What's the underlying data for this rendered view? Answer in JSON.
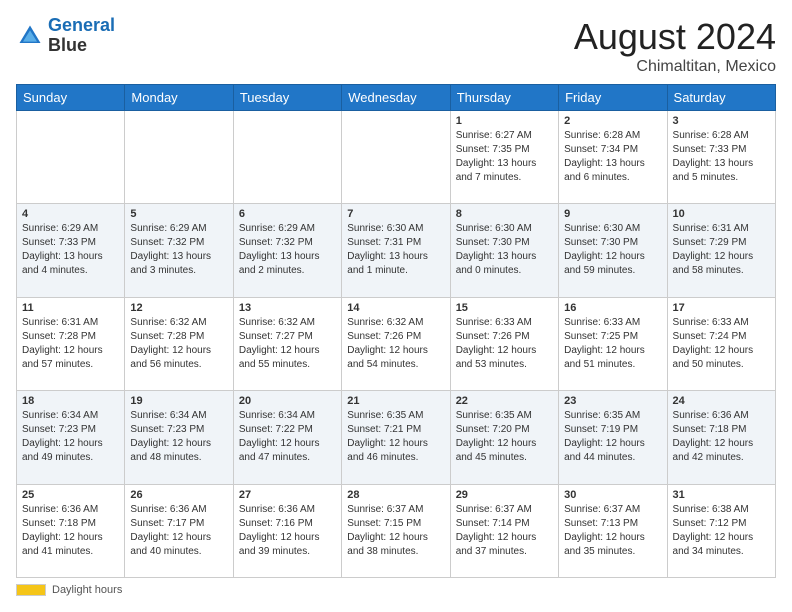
{
  "header": {
    "logo_line1": "General",
    "logo_line2": "Blue",
    "month": "August 2024",
    "location": "Chimaltitan, Mexico"
  },
  "days_of_week": [
    "Sunday",
    "Monday",
    "Tuesday",
    "Wednesday",
    "Thursday",
    "Friday",
    "Saturday"
  ],
  "weeks": [
    [
      {
        "day": "",
        "info": ""
      },
      {
        "day": "",
        "info": ""
      },
      {
        "day": "",
        "info": ""
      },
      {
        "day": "",
        "info": ""
      },
      {
        "day": "1",
        "info": "Sunrise: 6:27 AM\nSunset: 7:35 PM\nDaylight: 13 hours and 7 minutes."
      },
      {
        "day": "2",
        "info": "Sunrise: 6:28 AM\nSunset: 7:34 PM\nDaylight: 13 hours and 6 minutes."
      },
      {
        "day": "3",
        "info": "Sunrise: 6:28 AM\nSunset: 7:33 PM\nDaylight: 13 hours and 5 minutes."
      }
    ],
    [
      {
        "day": "4",
        "info": "Sunrise: 6:29 AM\nSunset: 7:33 PM\nDaylight: 13 hours and 4 minutes."
      },
      {
        "day": "5",
        "info": "Sunrise: 6:29 AM\nSunset: 7:32 PM\nDaylight: 13 hours and 3 minutes."
      },
      {
        "day": "6",
        "info": "Sunrise: 6:29 AM\nSunset: 7:32 PM\nDaylight: 13 hours and 2 minutes."
      },
      {
        "day": "7",
        "info": "Sunrise: 6:30 AM\nSunset: 7:31 PM\nDaylight: 13 hours and 1 minute."
      },
      {
        "day": "8",
        "info": "Sunrise: 6:30 AM\nSunset: 7:30 PM\nDaylight: 13 hours and 0 minutes."
      },
      {
        "day": "9",
        "info": "Sunrise: 6:30 AM\nSunset: 7:30 PM\nDaylight: 12 hours and 59 minutes."
      },
      {
        "day": "10",
        "info": "Sunrise: 6:31 AM\nSunset: 7:29 PM\nDaylight: 12 hours and 58 minutes."
      }
    ],
    [
      {
        "day": "11",
        "info": "Sunrise: 6:31 AM\nSunset: 7:28 PM\nDaylight: 12 hours and 57 minutes."
      },
      {
        "day": "12",
        "info": "Sunrise: 6:32 AM\nSunset: 7:28 PM\nDaylight: 12 hours and 56 minutes."
      },
      {
        "day": "13",
        "info": "Sunrise: 6:32 AM\nSunset: 7:27 PM\nDaylight: 12 hours and 55 minutes."
      },
      {
        "day": "14",
        "info": "Sunrise: 6:32 AM\nSunset: 7:26 PM\nDaylight: 12 hours and 54 minutes."
      },
      {
        "day": "15",
        "info": "Sunrise: 6:33 AM\nSunset: 7:26 PM\nDaylight: 12 hours and 53 minutes."
      },
      {
        "day": "16",
        "info": "Sunrise: 6:33 AM\nSunset: 7:25 PM\nDaylight: 12 hours and 51 minutes."
      },
      {
        "day": "17",
        "info": "Sunrise: 6:33 AM\nSunset: 7:24 PM\nDaylight: 12 hours and 50 minutes."
      }
    ],
    [
      {
        "day": "18",
        "info": "Sunrise: 6:34 AM\nSunset: 7:23 PM\nDaylight: 12 hours and 49 minutes."
      },
      {
        "day": "19",
        "info": "Sunrise: 6:34 AM\nSunset: 7:23 PM\nDaylight: 12 hours and 48 minutes."
      },
      {
        "day": "20",
        "info": "Sunrise: 6:34 AM\nSunset: 7:22 PM\nDaylight: 12 hours and 47 minutes."
      },
      {
        "day": "21",
        "info": "Sunrise: 6:35 AM\nSunset: 7:21 PM\nDaylight: 12 hours and 46 minutes."
      },
      {
        "day": "22",
        "info": "Sunrise: 6:35 AM\nSunset: 7:20 PM\nDaylight: 12 hours and 45 minutes."
      },
      {
        "day": "23",
        "info": "Sunrise: 6:35 AM\nSunset: 7:19 PM\nDaylight: 12 hours and 44 minutes."
      },
      {
        "day": "24",
        "info": "Sunrise: 6:36 AM\nSunset: 7:18 PM\nDaylight: 12 hours and 42 minutes."
      }
    ],
    [
      {
        "day": "25",
        "info": "Sunrise: 6:36 AM\nSunset: 7:18 PM\nDaylight: 12 hours and 41 minutes."
      },
      {
        "day": "26",
        "info": "Sunrise: 6:36 AM\nSunset: 7:17 PM\nDaylight: 12 hours and 40 minutes."
      },
      {
        "day": "27",
        "info": "Sunrise: 6:36 AM\nSunset: 7:16 PM\nDaylight: 12 hours and 39 minutes."
      },
      {
        "day": "28",
        "info": "Sunrise: 6:37 AM\nSunset: 7:15 PM\nDaylight: 12 hours and 38 minutes."
      },
      {
        "day": "29",
        "info": "Sunrise: 6:37 AM\nSunset: 7:14 PM\nDaylight: 12 hours and 37 minutes."
      },
      {
        "day": "30",
        "info": "Sunrise: 6:37 AM\nSunset: 7:13 PM\nDaylight: 12 hours and 35 minutes."
      },
      {
        "day": "31",
        "info": "Sunrise: 6:38 AM\nSunset: 7:12 PM\nDaylight: 12 hours and 34 minutes."
      }
    ]
  ],
  "footer": {
    "label": "Daylight hours"
  }
}
